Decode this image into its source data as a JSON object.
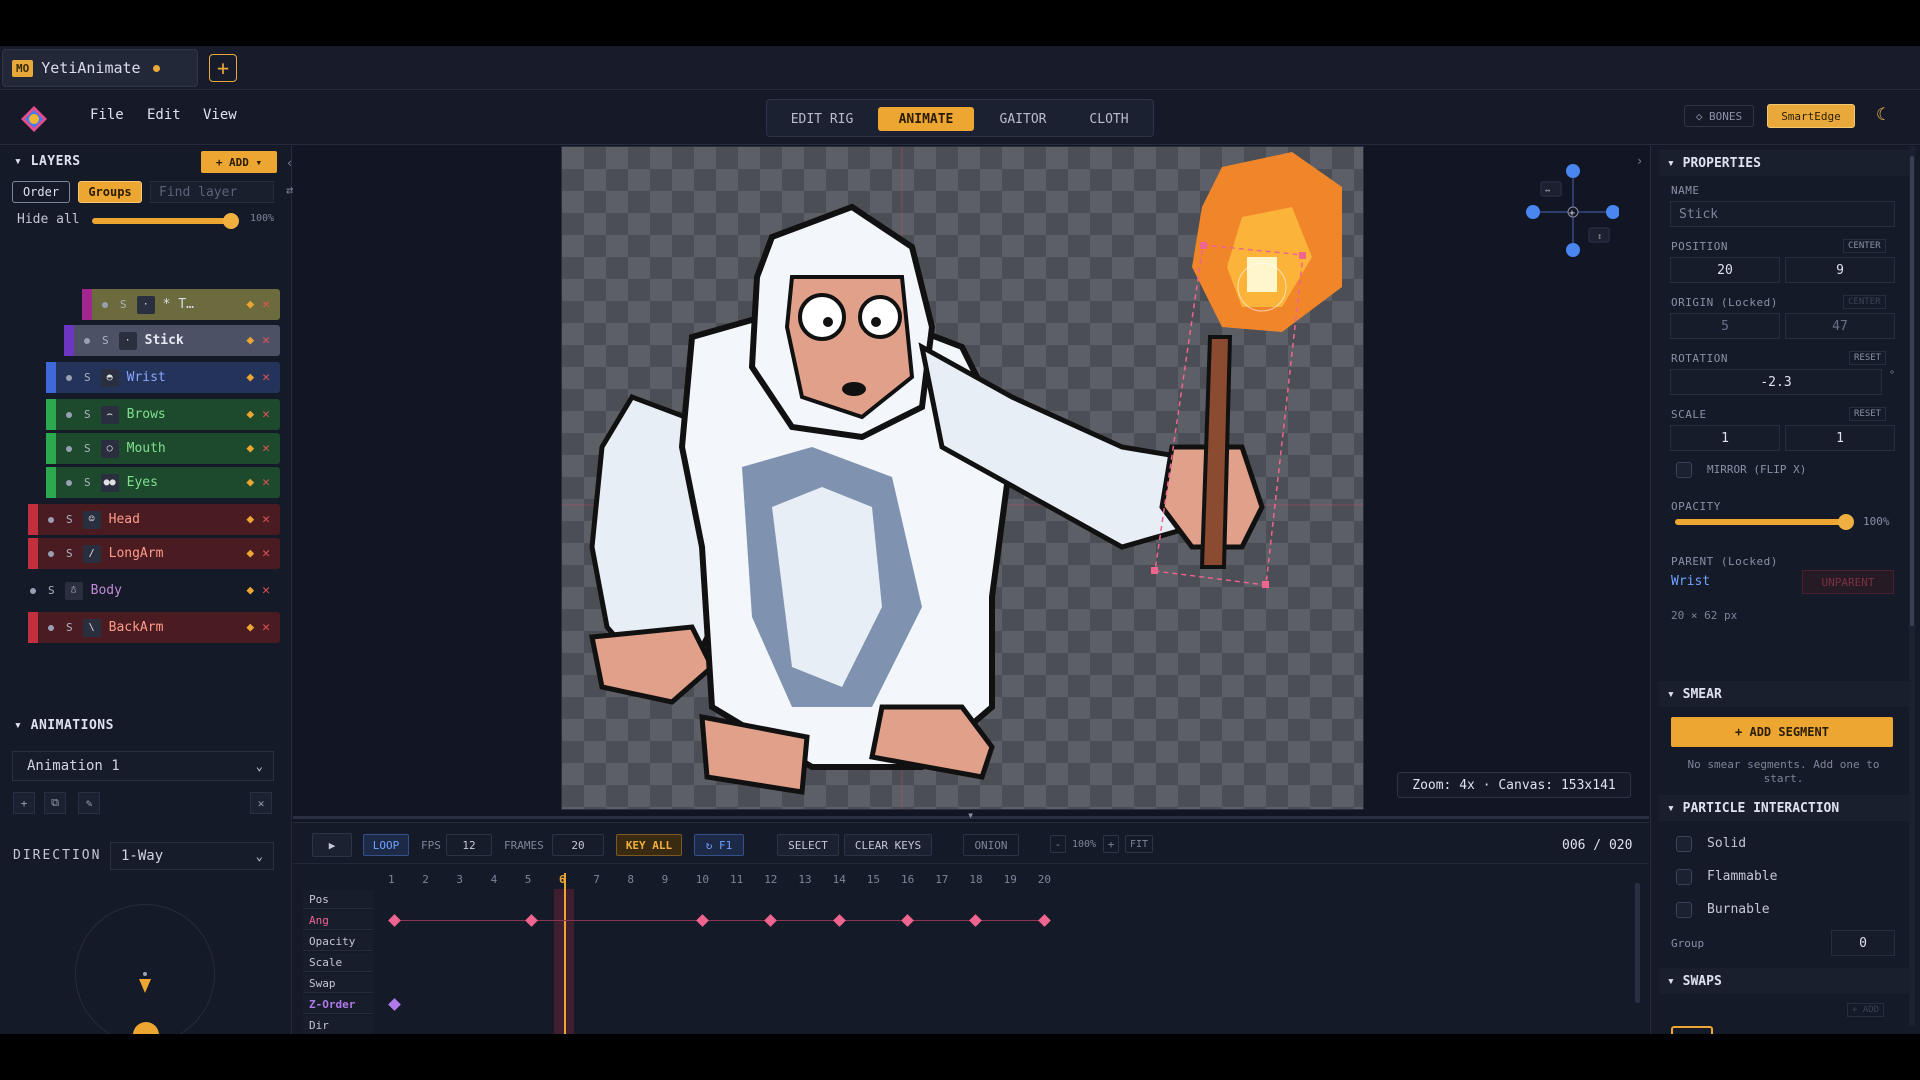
{
  "tab": {
    "badge": "MO",
    "title": "YetiAnimate",
    "new_tab": "+"
  },
  "menu": {
    "file": "File",
    "edit": "Edit",
    "view": "View"
  },
  "modes": [
    "EDIT RIG",
    "ANIMATE",
    "GAITOR",
    "CLOTH"
  ],
  "header_right": {
    "bones": "◇ BONES",
    "smartedge": "SmartEdge"
  },
  "layers": {
    "title": "LAYERS",
    "add": "+ ADD ▾",
    "order": "Order",
    "groups": "Groups",
    "find_placeholder": "Find layer",
    "hide_all": "Hide all",
    "opacity": "100%",
    "items": [
      {
        "s": "S",
        "name": "* T…",
        "color": "#6b6b3d",
        "stripe": "#a1268e"
      },
      {
        "s": "S",
        "name": "Stick",
        "color": "#4d5166",
        "stripe": "#6c35c2"
      },
      {
        "s": "S",
        "name": "Wrist",
        "color": "#23335a",
        "stripe": "#3f68d8"
      },
      {
        "s": "S",
        "name": "Brows",
        "color": "#1d4a2c",
        "stripe": "#2ca84e"
      },
      {
        "s": "S",
        "name": "Mouth",
        "color": "#1d4a2c",
        "stripe": "#2ca84e"
      },
      {
        "s": "S",
        "name": "Eyes",
        "color": "#1d4a2c",
        "stripe": "#2ca84e"
      },
      {
        "s": "S",
        "name": "Head",
        "color": "#4a1c22",
        "stripe": "#c1303c"
      },
      {
        "s": "S",
        "name": "LongArm",
        "color": "#4a1c22",
        "stripe": "#c1303c"
      },
      {
        "s": "S",
        "name": "Body",
        "color": "#151a28",
        "stripe": "#151a28"
      },
      {
        "s": "S",
        "name": "BackArm",
        "color": "#4a1c22",
        "stripe": "#c1303c"
      }
    ]
  },
  "animations": {
    "title": "ANIMATIONS",
    "selected": "Animation 1",
    "buttons": [
      "+",
      "⧉",
      "✎",
      "✕"
    ],
    "direction_label": "DIRECTION",
    "direction": "1-Way"
  },
  "canvas": {
    "zoom_info": "Zoom: 4x · Canvas: 153x141"
  },
  "timeline": {
    "loop": "LOOP",
    "fps_label": "FPS",
    "fps": "12",
    "frames_label": "FRAMES",
    "frames": "20",
    "key_all": "KEY ALL",
    "f1": "↻ F1",
    "select": "SELECT",
    "clear_keys": "CLEAR KEYS",
    "onion": "ONION",
    "zoom_minus": "-",
    "zoom_pct": "100%",
    "zoom_plus": "+",
    "fit": "FIT",
    "counter": "006 / 020",
    "frame_numbers": [
      "1",
      "2",
      "3",
      "4",
      "5",
      "6",
      "7",
      "8",
      "9",
      "10",
      "11",
      "12",
      "13",
      "14",
      "15",
      "16",
      "17",
      "18",
      "19",
      "20"
    ],
    "current_frame": 6,
    "tracks": [
      "Pos",
      "Ang",
      "Opacity",
      "Scale",
      "Swap",
      "Z-Order",
      "Dir"
    ],
    "ang_keys": [
      1,
      5,
      10,
      12,
      14,
      16,
      18,
      20
    ],
    "zorder_keys": [
      1
    ]
  },
  "properties": {
    "title": "PROPERTIES",
    "name_label": "NAME",
    "name": "Stick",
    "position_label": "POSITION",
    "center": "CENTER",
    "pos_x": "20",
    "pos_y": "9",
    "origin_label": "ORIGIN (Locked)",
    "origin_x": "5",
    "origin_y": "47",
    "rotation_label": "ROTATION",
    "reset": "RESET",
    "rotation": "-2.3",
    "degree": "°",
    "scale_label": "SCALE",
    "scale_x": "1",
    "scale_y": "1",
    "mirror": "MIRROR (FLIP X)",
    "opacity_label": "OPACITY",
    "opacity": "100%",
    "parent_label": "PARENT (Locked)",
    "parent": "Wrist",
    "unparent": "UNPARENT",
    "size": "20 × 62 px"
  },
  "smear": {
    "title": "SMEAR",
    "add": "+ ADD SEGMENT",
    "empty": "No smear segments. Add one to start."
  },
  "particle": {
    "title": "PARTICLE INTERACTION",
    "solid": "Solid",
    "flammable": "Flammable",
    "burnable": "Burnable",
    "group_label": "Group",
    "group": "0"
  },
  "swaps": {
    "title": "SWAPS",
    "add": "+ ADD"
  },
  "colors": {
    "accent": "#eea632",
    "key": "#f06490",
    "bg": "#121624"
  }
}
